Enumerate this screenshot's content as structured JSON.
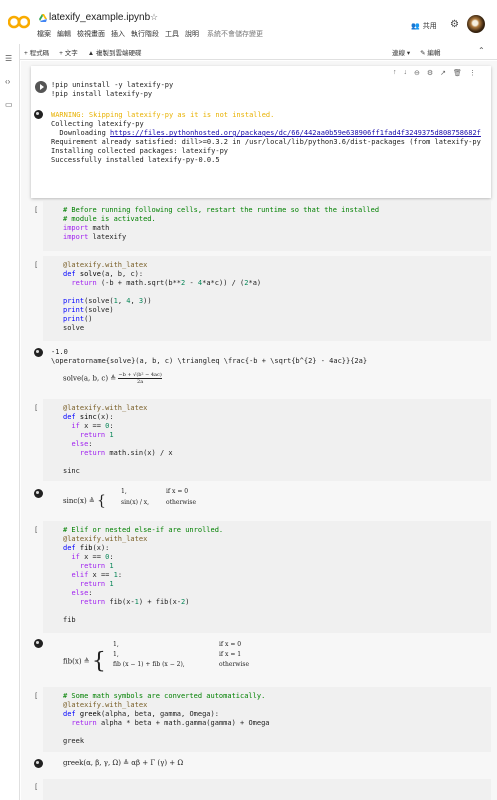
{
  "header": {
    "title": "latexify_example.ipynb",
    "menu": [
      "檔案",
      "編輯",
      "檢視畫面",
      "插入",
      "執行階段",
      "工具",
      "說明"
    ],
    "save_note": "系統不會儲存變更",
    "share_label": "共用"
  },
  "toolbar": {
    "add_code": "+ 程式碼",
    "add_text": "+ 文字",
    "copy_drive": "複製到雲端硬碟",
    "connect": "連線",
    "edit": "編輯"
  },
  "cells": {
    "c1": {
      "lines": [
        "!pip uninstall -y latexify-py",
        "!pip install latexify-py"
      ],
      "out_warn": "WARNING: Skipping latexify-py as it is not installed.",
      "out_lines": [
        "Collecting latexify-py",
        "  Downloading ",
        "Requirement already satisfied: dill>=0.3.2 in /usr/local/lib/python3.6/dist-packages (from latexify-py",
        "Installing collected packages: latexify-py",
        "Successfully installed latexify-py-0.0.5"
      ],
      "out_link": "https://files.pythonhosted.org/packages/dc/66/442aa0b59e638906ff1fad4f3249375d808758682f"
    },
    "c2": {
      "bracket": "[ ]",
      "lines": [
        "# Before running following cells, restart the runtime so that the installed",
        "# module is activated.",
        "import math",
        "import latexify"
      ]
    },
    "c3": {
      "bracket": "[ ]",
      "lines": [
        "@latexify.with_latex",
        "def solve(a, b, c):",
        "  return (-b + math.sqrt(b**2 - 4*a*c)) / (2*a)",
        "",
        "print(solve(1, 4, 3))",
        "print(solve)",
        "print()",
        "solve"
      ],
      "out_lines": [
        "-1.0",
        "\\operatorname{solve}(a, b, c) \\triangleq \\frac{-b + \\sqrt{b^{2} - 4ac}}{2a}"
      ],
      "math": "solve(a, b, c) ≜ "
    },
    "c4": {
      "bracket": "[ ]",
      "lines": [
        "@latexify.with_latex",
        "def sinc(x):",
        "  if x == 0:",
        "    return 1",
        "  else:",
        "    return math.sin(x) / x",
        "",
        "sinc"
      ],
      "math_lhs": "sinc(x) ≜ ",
      "math_cases": [
        "1,",
        "sin(x) / x,"
      ],
      "math_conds": [
        "if x = 0",
        "otherwise"
      ]
    },
    "c5": {
      "bracket": "[ ]",
      "lines": [
        "# Elif or nested else-if are unrolled.",
        "@latexify.with_latex",
        "def fib(x):",
        "  if x == 0:",
        "    return 1",
        "  elif x == 1:",
        "    return 1",
        "  else:",
        "    return fib(x-1) + fib(x-2)",
        "",
        "fib"
      ],
      "math_lhs": "fib(x) ≜ ",
      "math_cases": [
        "1,",
        "1,",
        "fib (x − 1) + fib (x − 2),"
      ],
      "math_conds": [
        "if x = 0",
        "if x = 1",
        "otherwise"
      ]
    },
    "c6": {
      "bracket": "[ ]",
      "lines": [
        "# Some math symbols are converted automatically.",
        "@latexify.with_latex",
        "def greek(alpha, beta, gamma, Omega):",
        "  return alpha * beta + math.gamma(gamma) + Omega",
        "",
        "greek"
      ],
      "math": "greek(α, β, γ, Ω) ≜ αβ + Γ (γ) + Ω"
    },
    "c7": {
      "bracket": "[ ]"
    }
  },
  "colors": {
    "accent": "#f9ab00",
    "bg": "#f7f7f7",
    "code_bg": "#f0f0f0"
  }
}
